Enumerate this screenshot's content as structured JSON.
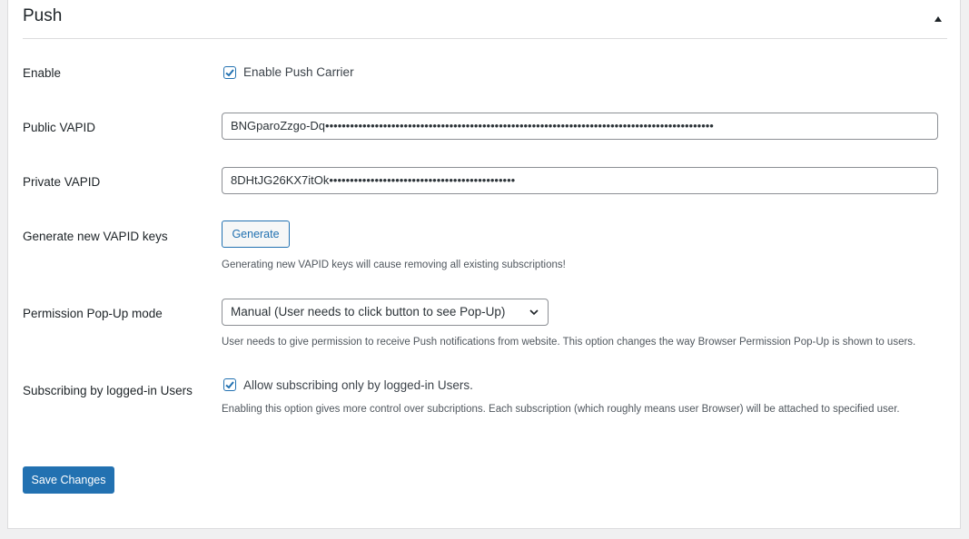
{
  "panel": {
    "title": "Push"
  },
  "enable": {
    "label": "Enable",
    "checkbox_label": "Enable Push Carrier",
    "checked": true
  },
  "public_vapid": {
    "label": "Public VAPID",
    "value": "BNGparoZzgo-Dq••••••••••••••••••••••••••••••••••••••••••••••••••••••••••••••••••••••••••••••••••••••••••••••"
  },
  "private_vapid": {
    "label": "Private VAPID",
    "value": "8DHtJG26KX7itOk•••••••••••••••••••••••••••••••••••••••••••••"
  },
  "generate": {
    "label": "Generate new VAPID keys",
    "button_label": "Generate",
    "description": "Generating new VAPID keys will cause removing all existing subscriptions!"
  },
  "popup_mode": {
    "label": "Permission Pop-Up mode",
    "selected": "Manual (User needs to click button to see Pop-Up)",
    "description": "User needs to give permission to receive Push notifications from website. This option changes the way Browser Permission Pop-Up is shown to users."
  },
  "logged_in": {
    "label": "Subscribing by logged-in Users",
    "checkbox_label": "Allow subscribing only by logged-in Users.",
    "checked": true,
    "description": "Enabling this option gives more control over subcriptions. Each subscription (which roughly means user Browser) will be attached to specified user."
  },
  "save": {
    "label": "Save Changes"
  },
  "colors": {
    "accent": "#2271b1",
    "background": "#f0f0f1"
  },
  "icons": {
    "collapse": "caret-up-icon",
    "check": "checkmark-icon",
    "select": "chevron-down-icon"
  }
}
